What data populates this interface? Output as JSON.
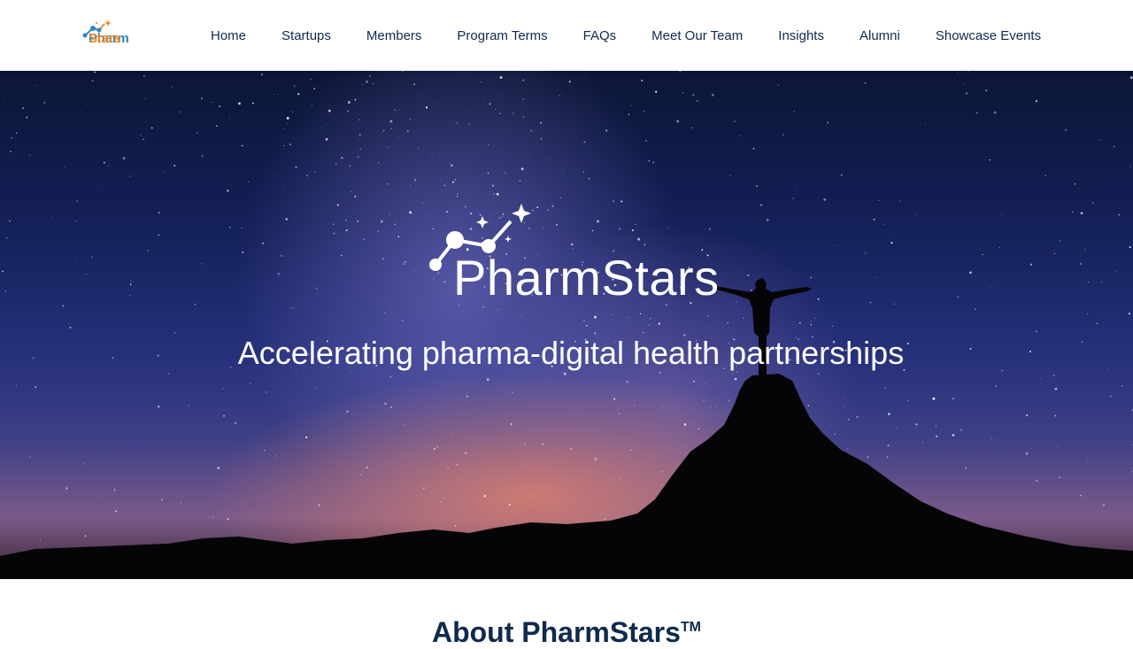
{
  "header": {
    "logo": {
      "pharm": "Pharm",
      "stars": "Stars",
      "icon": "pharmstars-logo-icon"
    },
    "nav": [
      {
        "label": "Home"
      },
      {
        "label": "Startups"
      },
      {
        "label": "Members"
      },
      {
        "label": "Program Terms"
      },
      {
        "label": "FAQs"
      },
      {
        "label": "Meet Our Team"
      },
      {
        "label": "Insights"
      },
      {
        "label": "Alumni"
      },
      {
        "label": "Showcase Events"
      }
    ]
  },
  "hero": {
    "logo_text": "PharmStars",
    "tagline": "Accelerating pharma-digital health partnerships"
  },
  "about": {
    "heading": "About PharmStars",
    "trademark": "TM"
  },
  "colors": {
    "nav_text": "#0f2a4d",
    "logo_blue": "#2f86c4",
    "logo_orange": "#f2861e",
    "hero_text": "#ffffff"
  }
}
